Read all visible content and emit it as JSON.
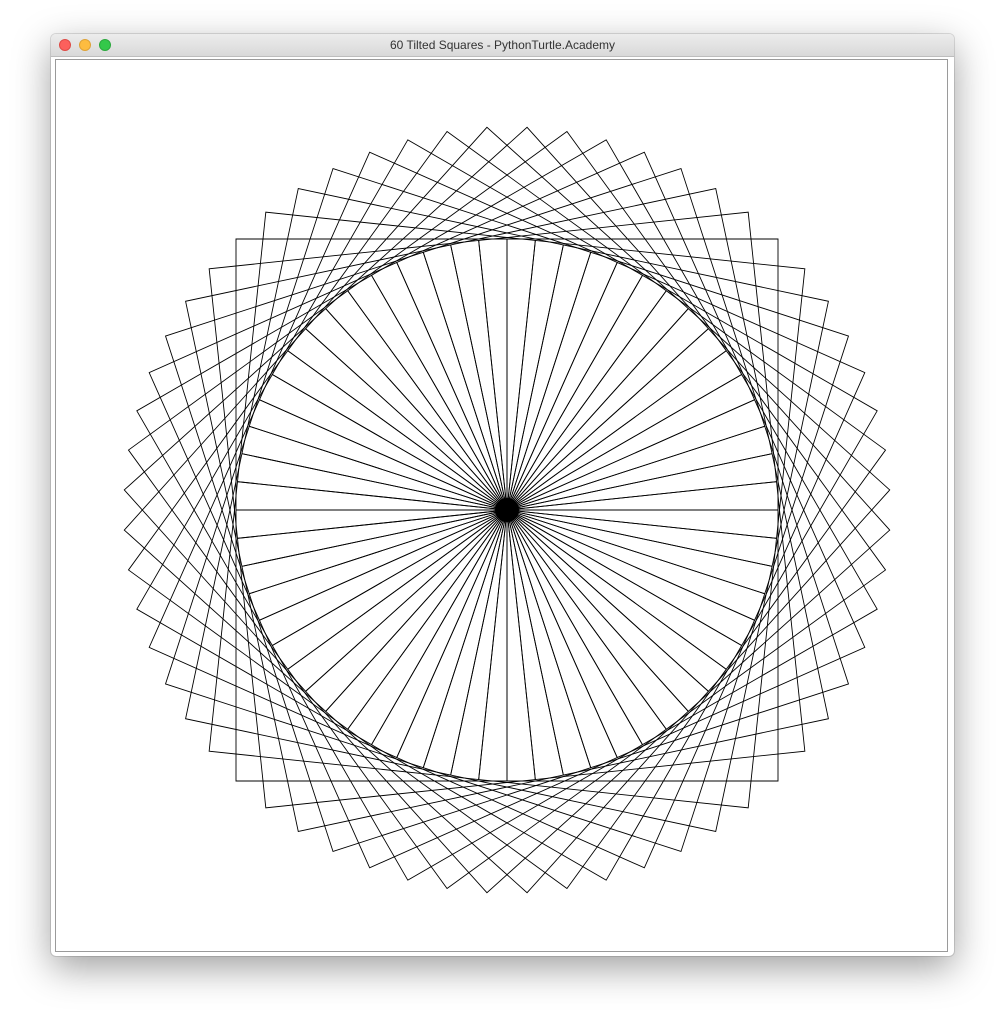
{
  "window": {
    "title": "60 Tilted Squares - PythonTurtle.Academy"
  },
  "drawing": {
    "square_count": 60,
    "rotation_step_degrees": 6,
    "stroke_color": "#000000",
    "background_color": "#ffffff",
    "center_dot_color": "#000000"
  },
  "icons": {
    "close": "close-icon",
    "minimize": "minimize-icon",
    "maximize": "maximize-icon"
  }
}
